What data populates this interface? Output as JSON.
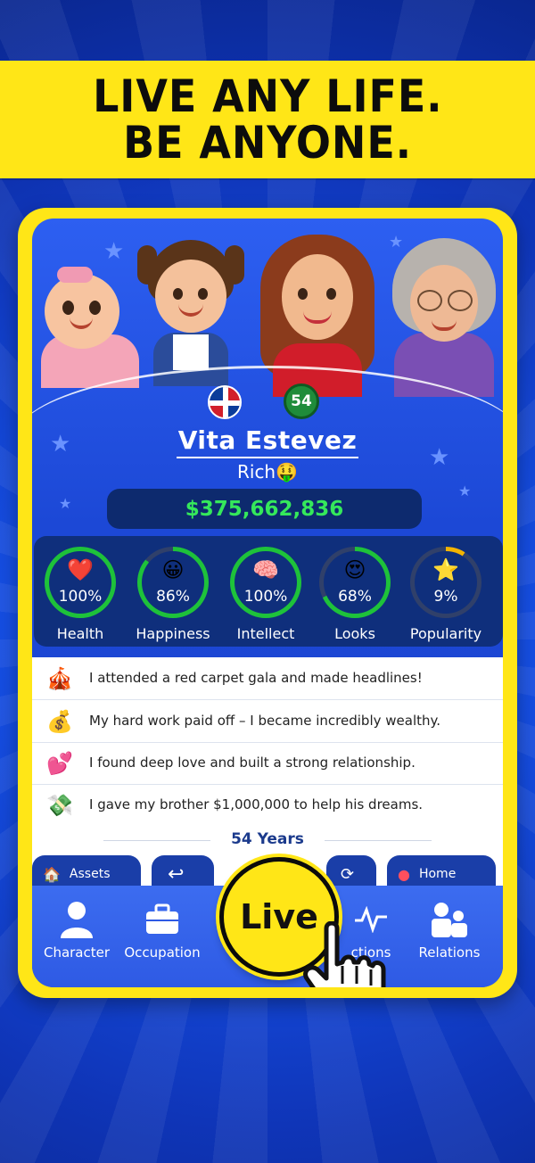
{
  "banner": {
    "line1": "LIVE ANY LIFE.",
    "line2": "BE ANYONE."
  },
  "profile": {
    "age": "54",
    "name": "Vita Estevez",
    "status": "Rich",
    "status_emoji": "🤑",
    "money": "$375,662,836"
  },
  "stats": [
    {
      "label": "Health",
      "value": "100%",
      "percent": 100,
      "icon": "heart-icon",
      "glyph": "❤️",
      "ring_color": "#1ec23a"
    },
    {
      "label": "Happiness",
      "value": "86%",
      "percent": 86,
      "icon": "smiley-icon",
      "glyph": "😀",
      "ring_color": "#1ec23a"
    },
    {
      "label": "Intellect",
      "value": "100%",
      "percent": 100,
      "icon": "brain-icon",
      "glyph": "🧠",
      "ring_color": "#1ec23a"
    },
    {
      "label": "Looks",
      "value": "68%",
      "percent": 68,
      "icon": "heart-eyes-icon",
      "glyph": "😍",
      "ring_color": "#1ec23a"
    },
    {
      "label": "Popularity",
      "value": "9%",
      "percent": 9,
      "icon": "star-icon",
      "glyph": "⭐",
      "ring_color": "#f4b400"
    }
  ],
  "feed": [
    {
      "text": "I attended a red carpet gala and made headlines!",
      "icon": "red-carpet-icon",
      "glyph": "🎪"
    },
    {
      "text": "My hard work paid off – I became incredibly wealthy.",
      "icon": "money-bag-icon",
      "glyph": "💰"
    },
    {
      "text": "I found deep love and built a strong relationship.",
      "icon": "two-hearts-icon",
      "glyph": "💕"
    },
    {
      "text": "I gave my brother $1,000,000 to help his dreams.",
      "icon": "cash-hand-icon",
      "glyph": "💸"
    }
  ],
  "years_label": "54 Years",
  "tabs": {
    "assets": "Assets",
    "home": "Home"
  },
  "nav": {
    "character": "Character",
    "occupation": "Occupation",
    "activities": "ctions",
    "relations": "Relations",
    "live": "Live"
  },
  "colors": {
    "banner_yellow": "#ffe617",
    "money_green": "#35e85b",
    "accent_blue": "#1c48d6"
  }
}
